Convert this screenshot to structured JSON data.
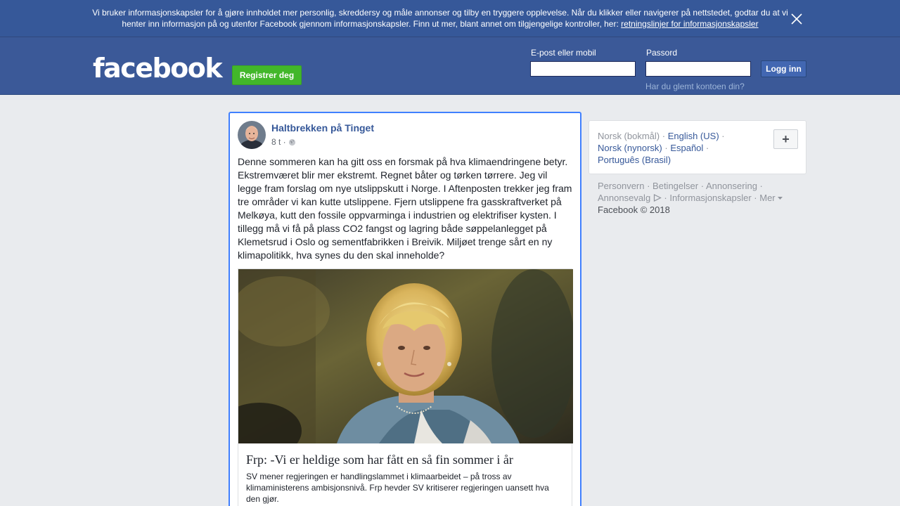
{
  "cookie_banner": {
    "text": "Vi bruker informasjonskapsler for å gjøre innholdet mer personlig, skreddersy og måle annonser og tilby en tryggere opplevelse. Når du klikker eller navigerer på nettstedet, godtar du at vi henter inn informasjon på og utenfor Facebook gjennom informasjonskapsler. Finn ut mer, blant annet om tilgjengelige kontroller, her:",
    "link": "retningslinjer for informasjonskapsler"
  },
  "header": {
    "logo": "facebook",
    "register_label": "Registrer deg",
    "email_label": "E-post eller mobil",
    "email_value": "",
    "password_label": "Passord",
    "password_value": "",
    "login_label": "Logg inn",
    "forgot_label": "Har du glemt kontoen din?"
  },
  "post": {
    "author": "Haltbrekken på Tinget",
    "time": "8 t ·",
    "body": "Denne sommeren kan ha gitt oss en forsmak på hva klimaendringene betyr. Ekstremværet blir mer ekstremt. Regnet båter og tørken tørrere. Jeg vil legge fram forslag om nye utslippskutt i Norge. I Aftenposten trekker jeg fram tre områder vi kan kutte utslippene. Fjern utslippene fra gasskraftverket på Melkøya, kutt den fossile oppvarminga i industrien og elektrifiser kysten. I tillegg må vi få på plass CO2 fangst og lagring både søppelanlegget på Klemetsrud i Oslo og sementfabrikken i Breivik. Miljøet trenge sårt en ny klimapolitikk, hva synes du den skal inneholde?",
    "link_preview": {
      "title": "Frp: -Vi er heldige som har fått en så fin sommer i år",
      "description": "SV mener regjeringen er handlingslammet i klimaarbeidet – på tross av klimaministerens ambisjonsnivå. Frp hevder SV kritiserer regjeringen uansett hva den gjør."
    }
  },
  "languages": {
    "current": "Norsk (bokmål)",
    "options": [
      "English (US)",
      "Norsk (nynorsk)",
      "Español",
      "Português (Brasil)"
    ],
    "add_label": "+"
  },
  "footer": {
    "links": [
      "Personvern",
      "Betingelser",
      "Annonsering",
      "Annonsevalg",
      "Informasjonskapsler",
      "Mer"
    ],
    "copyright": "Facebook © 2018"
  },
  "colors": {
    "brand_blue": "#3b5998",
    "banner_blue": "#365899",
    "register_green": "#42b72a",
    "focus_blue": "#4080ff",
    "link_blue": "#365899"
  },
  "icons": [
    "close-icon",
    "globe-icon",
    "ad-choices-icon",
    "caret-down-icon"
  ]
}
